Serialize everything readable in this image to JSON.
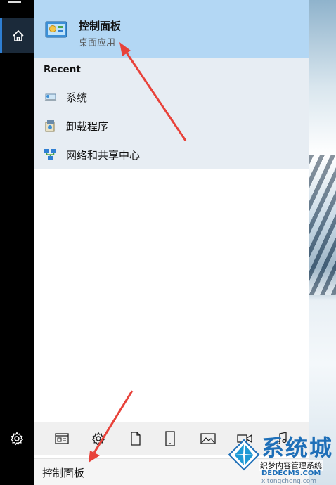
{
  "best_match": {
    "title": "控制面板",
    "subtitle": "桌面应用",
    "icon": "control-panel-icon"
  },
  "recent": {
    "heading": "Recent",
    "items": [
      {
        "label": "系统",
        "icon": "system-icon"
      },
      {
        "label": "卸载程序",
        "icon": "uninstall-program-icon"
      },
      {
        "label": "网络和共享中心",
        "icon": "network-sharing-icon"
      }
    ]
  },
  "filters": [
    {
      "name": "apps-filter",
      "icon": "apps-icon"
    },
    {
      "name": "settings-filter",
      "icon": "gear-icon"
    },
    {
      "name": "documents-filter",
      "icon": "document-icon"
    },
    {
      "name": "folders-filter",
      "icon": "tablet-icon"
    },
    {
      "name": "photos-filter",
      "icon": "photo-icon"
    },
    {
      "name": "videos-filter",
      "icon": "video-icon"
    },
    {
      "name": "music-filter",
      "icon": "music-icon"
    }
  ],
  "search": {
    "value": "控制面板"
  },
  "watermark": {
    "big_text": "系统城",
    "line1": "织梦内容管理系统",
    "line2": "DEDECMS.COM",
    "line3": "xitongcheng.com"
  },
  "colors": {
    "highlight": "#b3d7f4",
    "recent_bg": "#e7edf3",
    "sidebar": "#000000",
    "arrow": "#e8423a"
  }
}
